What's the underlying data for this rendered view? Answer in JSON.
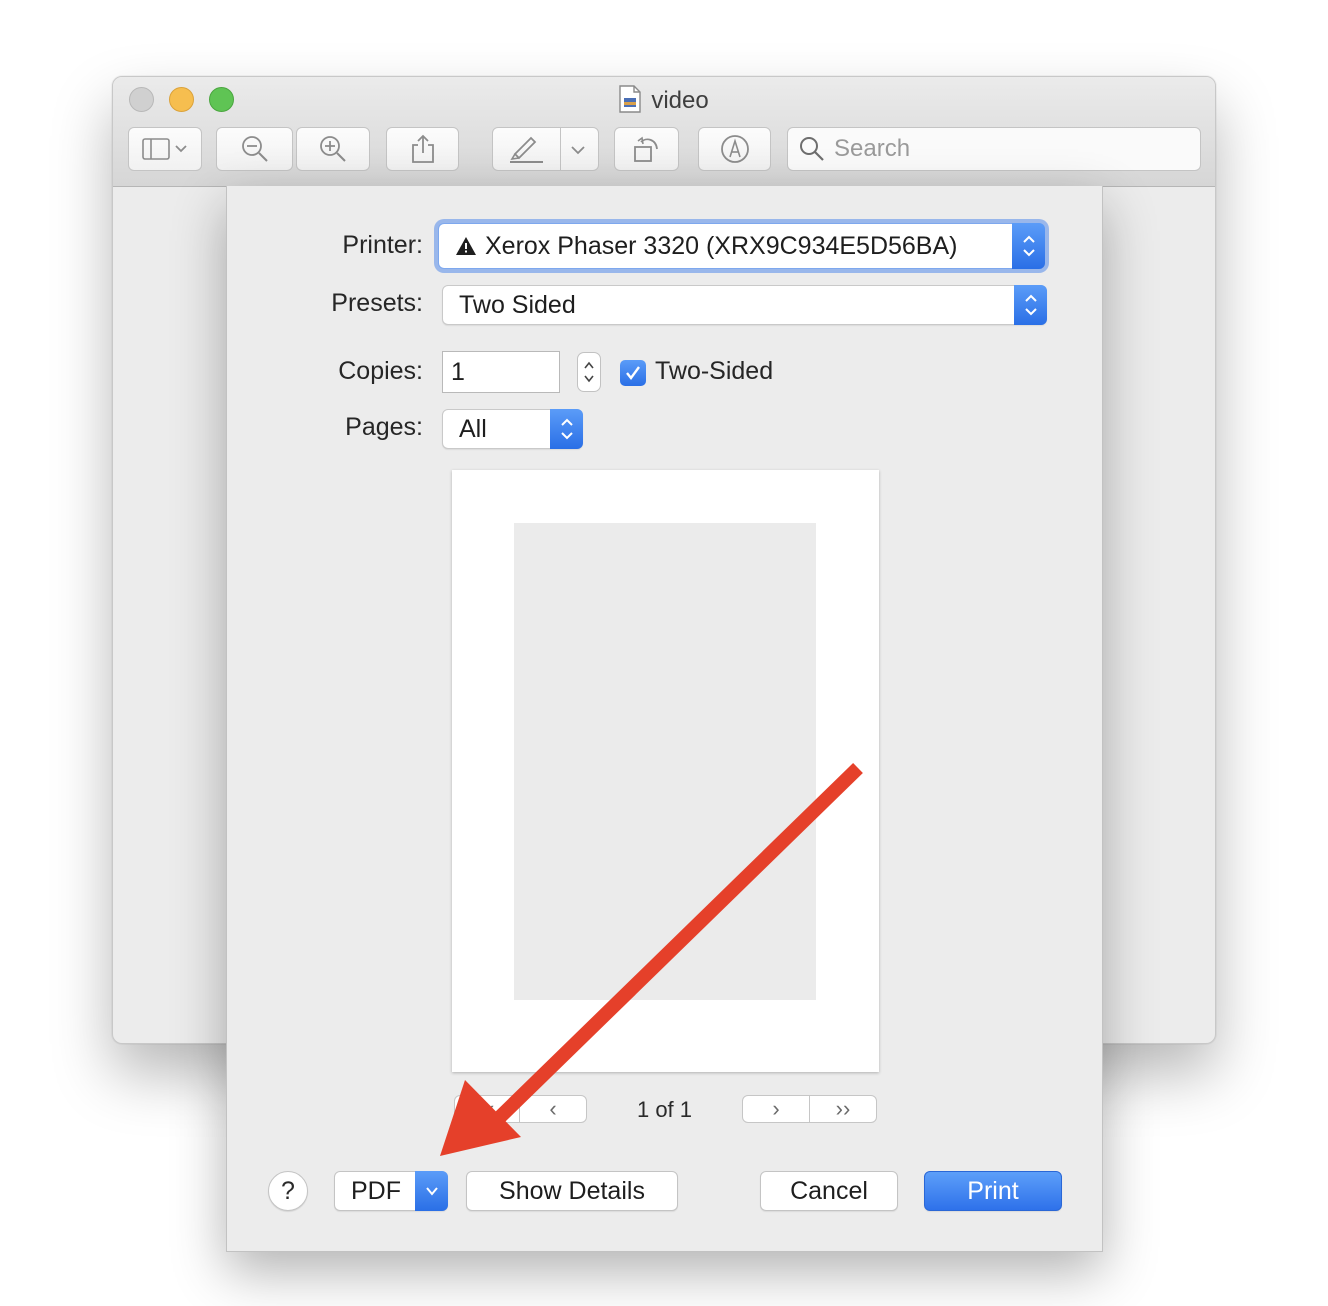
{
  "window": {
    "title": "video",
    "toolbar": {
      "sidebar_icon": "sidebar-icon",
      "zoom_out_icon": "zoom-out-icon",
      "zoom_in_icon": "zoom-in-icon",
      "share_icon": "share-icon",
      "highlight_icon": "highlighter-icon",
      "rotate_icon": "rotate-icon",
      "markup_icon": "markup-icon",
      "search_placeholder": "Search"
    }
  },
  "print_dialog": {
    "printer": {
      "label": "Printer:",
      "value": "Xerox Phaser 3320 (XRX9C934E5D56BA)",
      "warning_icon": "warning-icon"
    },
    "presets": {
      "label": "Presets:",
      "value": "Two Sided"
    },
    "copies": {
      "label": "Copies:",
      "value": "1"
    },
    "two_sided": {
      "label": "Two-Sided",
      "checked": true
    },
    "pages": {
      "label": "Pages:",
      "value": "All"
    },
    "preview": {
      "page_indicator": "1 of 1"
    },
    "buttons": {
      "help": "?",
      "pdf": "PDF",
      "show_details": "Show Details",
      "cancel": "Cancel",
      "print": "Print"
    }
  },
  "colors": {
    "accent": "#3478f6",
    "annotation_arrow": "#e5402a"
  }
}
